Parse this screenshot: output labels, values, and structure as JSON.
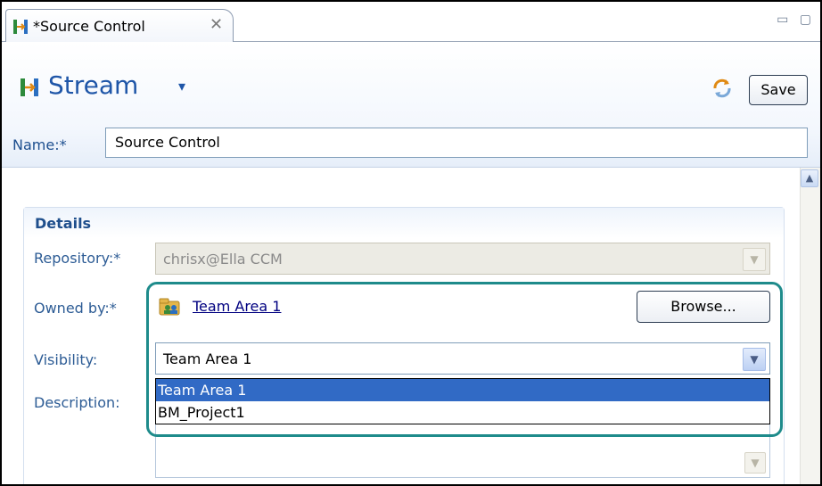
{
  "tab": {
    "title": "*Source Control",
    "close_glyph": "✕"
  },
  "window_controls": {
    "minimize": "▭",
    "maximize": "▢"
  },
  "header": {
    "title": "Stream",
    "caret": "▾",
    "save_label": "Save",
    "name_label": "Name:*",
    "name_value": "Source Control"
  },
  "details": {
    "section_title": "Details",
    "repository_label": "Repository:*",
    "repository_value": "chrisx@Ella CCM",
    "owned_by_label": "Owned by:*",
    "owned_by_value": "Team Area 1",
    "browse_label": "Browse...",
    "visibility_label": "Visibility:",
    "visibility_value": "Team Area 1",
    "visibility_options": [
      "Team Area 1",
      "BM_Project1"
    ],
    "description_label": "Description:"
  },
  "colors": {
    "accent": "#1f56a8",
    "selection": "#316ac5",
    "highlight_outline": "#1e8b8b"
  },
  "icons": {
    "tab": "stream-icon",
    "sync": "sync-icon",
    "team": "team-area-icon",
    "dropdown": "chevron-down-icon"
  }
}
